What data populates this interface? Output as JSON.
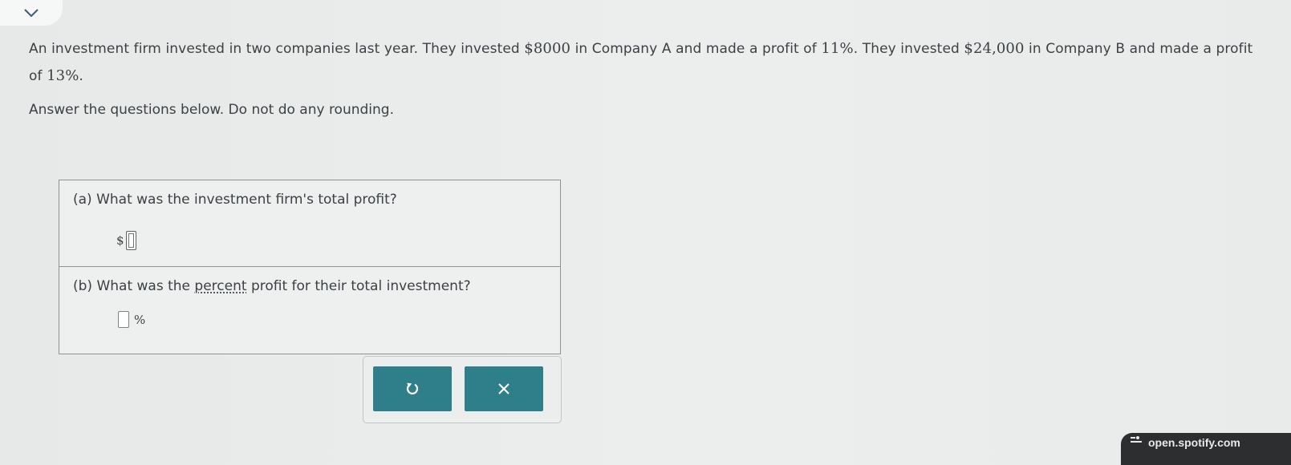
{
  "header": {
    "collapse_icon": "chevron-down-icon"
  },
  "problem": {
    "seg1": "An investment firm invested in two companies last year. They invested ",
    "amount_a": "$8000",
    "seg2": " in Company A and made a profit of ",
    "profit_a": "11%",
    "seg3": ". They invested ",
    "amount_b": "$24,000",
    "seg4": " in Company B and made a profit of ",
    "profit_b": "13%",
    "seg5": "."
  },
  "instructions": "Answer the questions below. Do not do any rounding.",
  "part_a": {
    "question": "(a) What was the investment firm's total profit?",
    "prefix": "$",
    "value": ""
  },
  "part_b": {
    "question_start": "(b) What was the ",
    "question_link": "percent",
    "question_end": " profit for their total investment?",
    "suffix": "%",
    "value": ""
  },
  "buttons": {
    "undo_icon": "undo-icon",
    "clear_icon": "close-icon"
  },
  "browser_overlay": {
    "text": "open.spotify.com",
    "icon": "media-control-icon"
  },
  "colors": {
    "accent": "#2f7f8a",
    "background": "#e9ebeb",
    "text": "#3b4144"
  }
}
